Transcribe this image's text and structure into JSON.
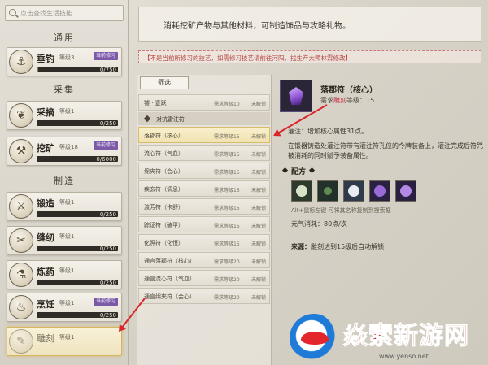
{
  "search": {
    "placeholder": "点击查找生活技能"
  },
  "sections": {
    "general": "通用",
    "gather": "采集",
    "craft": "制造"
  },
  "skills": [
    {
      "name": "垂钓",
      "level": "等级3",
      "badge": "当前修习",
      "progress": "0/750",
      "pct": 0.02
    },
    {
      "name": "采摘",
      "level": "等级1",
      "badge": "",
      "progress": "0/250",
      "pct": 0.0
    },
    {
      "name": "挖矿",
      "level": "等级18",
      "badge": "当前修习",
      "progress": "0/6000",
      "pct": 0.0
    },
    {
      "name": "锻造",
      "level": "等级1",
      "badge": "",
      "progress": "0/250",
      "pct": 0.0
    },
    {
      "name": "缝纫",
      "level": "等级1",
      "badge": "",
      "progress": "0/250",
      "pct": 0.0
    },
    {
      "name": "炼药",
      "level": "等级1",
      "badge": "",
      "progress": "0/250",
      "pct": 0.0
    },
    {
      "name": "烹饪",
      "level": "等级1",
      "badge": "当前修习",
      "progress": "0/250",
      "pct": 0.0
    },
    {
      "name": "雕刻",
      "level": "等级1",
      "badge": "",
      "progress": "",
      "pct": 0.0
    }
  ],
  "notice": "消耗挖矿产物与其他材料，可制造饰品与攻略礼物。",
  "warning": "【不是当前所修习的技艺，如需修习技艺请前往河阳，找生产大师林霖修改】",
  "filter_label": "筛选",
  "list": {
    "top_row": {
      "name": "饕 · 壹跃",
      "req": "需求等级10",
      "status": "未解锁"
    },
    "group": "对抗雷注符",
    "rows": [
      {
        "name": "落郡符（核心）",
        "req": "需求等级15",
        "status": "未解锁"
      },
      {
        "name": "流心符（气血）",
        "req": "需求等级15",
        "status": "未解锁"
      },
      {
        "name": "绵夹符（会心）",
        "req": "需求等级15",
        "status": "未解锁"
      },
      {
        "name": "疾玄符（调息）",
        "req": "需求等级15",
        "status": "未解锁"
      },
      {
        "name": "渡芳符（卡舒）",
        "req": "需求等级15",
        "status": "未解锁"
      },
      {
        "name": "踪证符（破甲）",
        "req": "需求等级15",
        "status": "未解锁"
      },
      {
        "name": "化照符（化恒）",
        "req": "需求等级15",
        "status": "未解锁"
      },
      {
        "name": "通宫落郡符（核心）",
        "req": "需求等级20",
        "status": "未解锁"
      },
      {
        "name": "通宫流心符（气血）",
        "req": "需求等级20",
        "status": "未解锁"
      },
      {
        "name": "通宫绵夹符（会心）",
        "req": "需求等级20",
        "status": "未解锁"
      }
    ]
  },
  "detail": {
    "name": "落郡符（核心）",
    "req_prefix": "需求",
    "req_highlight": "雕刻",
    "req_suffix": "等级：15",
    "desc1": "灌注：增加核心属性31点。",
    "desc2": "在锻器铸造处灌注符带有灌注符孔位的今牌装备上，灌注完成后符咒被消耗的同时赋予装备属性。",
    "formula_title": "配方",
    "alt_text": "Alt+鼠标左键 可将其名称复制到搜索框",
    "cost": "元气消耗：80点/次",
    "source_label": "来源：",
    "source": "雕刻达到15级后自动解锁"
  },
  "watermark": {
    "text": "焱索新游网",
    "url": "www.yenso.net"
  },
  "colors": {
    "accent_purple": "#7c5aa8",
    "warning_red": "#b5443f",
    "arrow_red": "#d9262a",
    "selected_gold": "#d7bc6c"
  }
}
